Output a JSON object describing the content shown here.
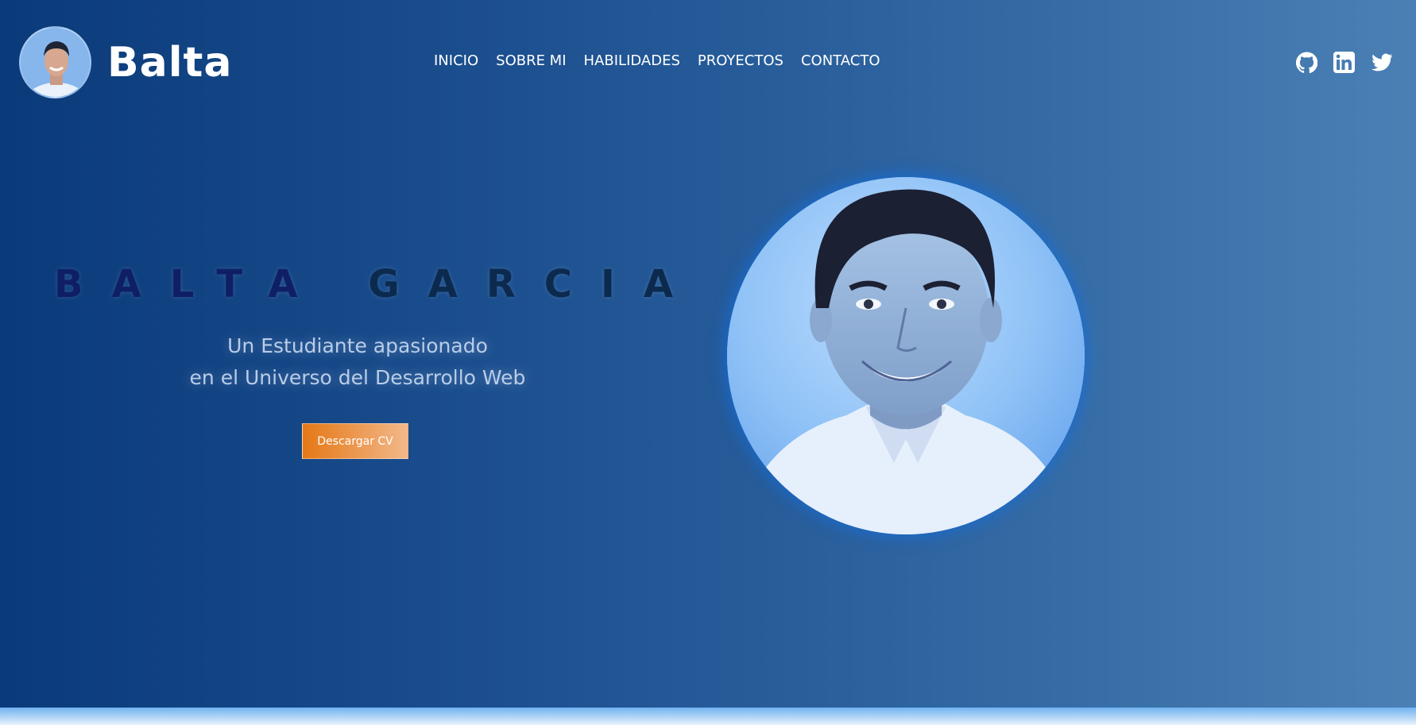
{
  "header": {
    "brand_name": "Balta",
    "nav": [
      "INICIO",
      "SOBRE MI",
      "HABILIDADES",
      "PROYECTOS",
      "CONTACTO"
    ],
    "socials": [
      "github-icon",
      "linkedin-icon",
      "twitter-icon"
    ]
  },
  "hero": {
    "name_first": "BALTA",
    "name_last": "GARCIA",
    "subtitle_line1": "Un Estudiante apasionado",
    "subtitle_line2": "en el Universo del Desarrollo Web",
    "cv_button": "Descargar CV"
  },
  "colors": {
    "accent": "#e57816",
    "name_color": "#0f1f66",
    "background_start": "#0a3a7a",
    "background_end": "#4a80b4"
  }
}
